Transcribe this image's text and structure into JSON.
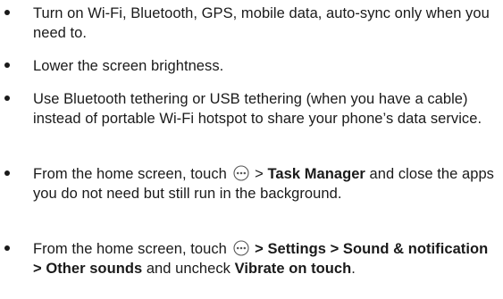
{
  "tips": [
    {
      "text": "Turn on Wi-Fi, Bluetooth, GPS, mobile data, auto-sync only when you need to."
    },
    {
      "text": "Lower the screen brightness."
    },
    {
      "text": "Use Bluetooth tethering or USB tethering (when you have a cable) instead of portable Wi-Fi hotspot to share your phone’s data service."
    },
    {
      "prefix": "From the home screen, touch",
      "icon": "apps-launcher-icon",
      "sep": ">",
      "bold": "Task Manager",
      "suffix": "and close the apps you do not need but still run in the background."
    },
    {
      "prefix": "From the home screen, touch",
      "icon": "apps-launcher-icon",
      "bold_path": "> Settings > Sound & notification > Other sounds",
      "middle": "and uncheck",
      "bold_end": "Vibrate on touch",
      "end": "."
    }
  ],
  "colors": {
    "text": "#1a1a1a",
    "icon_stroke": "#555555"
  }
}
